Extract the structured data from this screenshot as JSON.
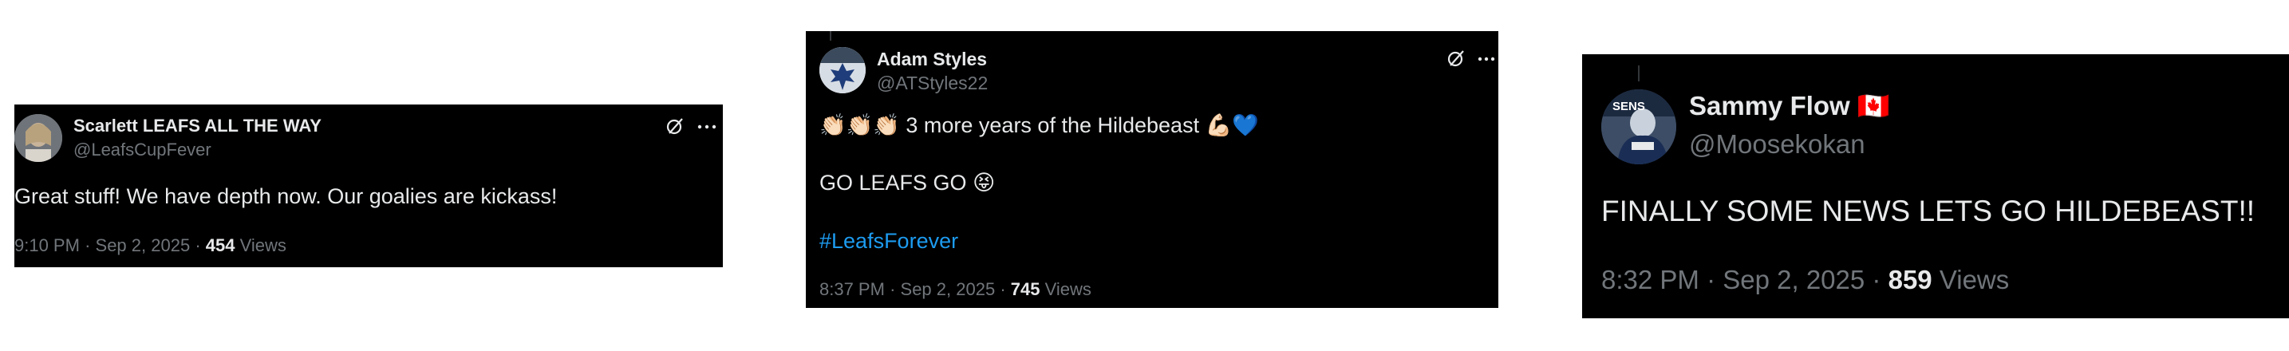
{
  "tweets": [
    {
      "display_name": "Scarlett LEAFS ALL THE WAY",
      "handle": "@LeafsCupFever",
      "lines": [
        "Great stuff! We have depth now. Our goalies are kickass!"
      ],
      "time": "9:10 PM",
      "date": "Sep 2, 2025",
      "views_count": "454",
      "views_label": "Views",
      "avatar_icon": "profile-photo",
      "actions": [
        "grok-icon",
        "more-icon"
      ]
    },
    {
      "display_name": "Adam Styles",
      "handle": "@ATStyles22",
      "line1_emoji": "👏🏻👏🏻👏🏻",
      "line1_text": "3 more years of the Hildebeast",
      "line1_trailing_emoji": "💪🏻💙",
      "line2_text": "GO LEAFS GO",
      "line2_emoji": "😝",
      "hashtag": "#LeafsForever",
      "time": "8:37 PM",
      "date": "Sep 2, 2025",
      "views_count": "745",
      "views_label": "Views",
      "avatar_icon": "maple-leafs-logo",
      "actions": [
        "grok-icon",
        "more-icon"
      ]
    },
    {
      "display_name": "Sammy Flow",
      "name_flag": "🇨🇦",
      "handle": "@Moosekokan",
      "lines": [
        "FINALLY SOME NEWS LETS GO HILDEBEAST!!"
      ],
      "time": "8:32 PM",
      "date": "Sep 2, 2025",
      "views_count": "859",
      "views_label": "Views",
      "avatar_icon": "hockey-player-photo",
      "avatar_text": "SENS"
    }
  ],
  "separator": "·",
  "colors": {
    "card_bg": "#000000",
    "text": "#e7e9ea",
    "muted": "#71767b",
    "link": "#1d9bf0"
  }
}
